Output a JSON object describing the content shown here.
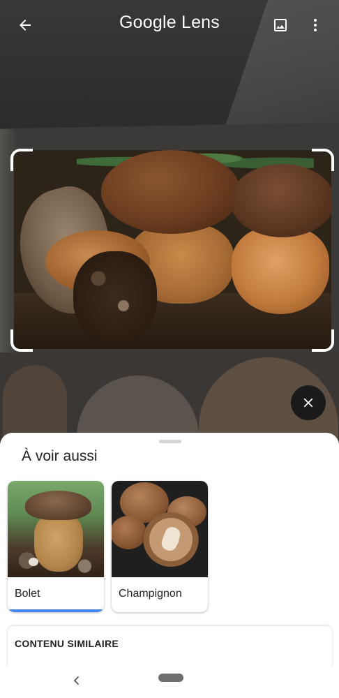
{
  "app": {
    "title": "Google Lens"
  },
  "icons": {
    "back": "arrow-left",
    "gallery": "image",
    "more": "more-vert",
    "close": "close",
    "nav_back": "chevron-left",
    "nav_home": "home-pill"
  },
  "sheet": {
    "title": "À voir aussi",
    "cards": [
      {
        "label": "Bolet",
        "selected": true
      },
      {
        "label": "Champignon",
        "selected": false
      }
    ],
    "related_title": "CONTENU SIMILAIRE"
  },
  "colors": {
    "accent": "#4285f4",
    "text_primary": "#202124",
    "sheet_bg": "#ffffff",
    "close_fab": "#1a1a1a"
  }
}
